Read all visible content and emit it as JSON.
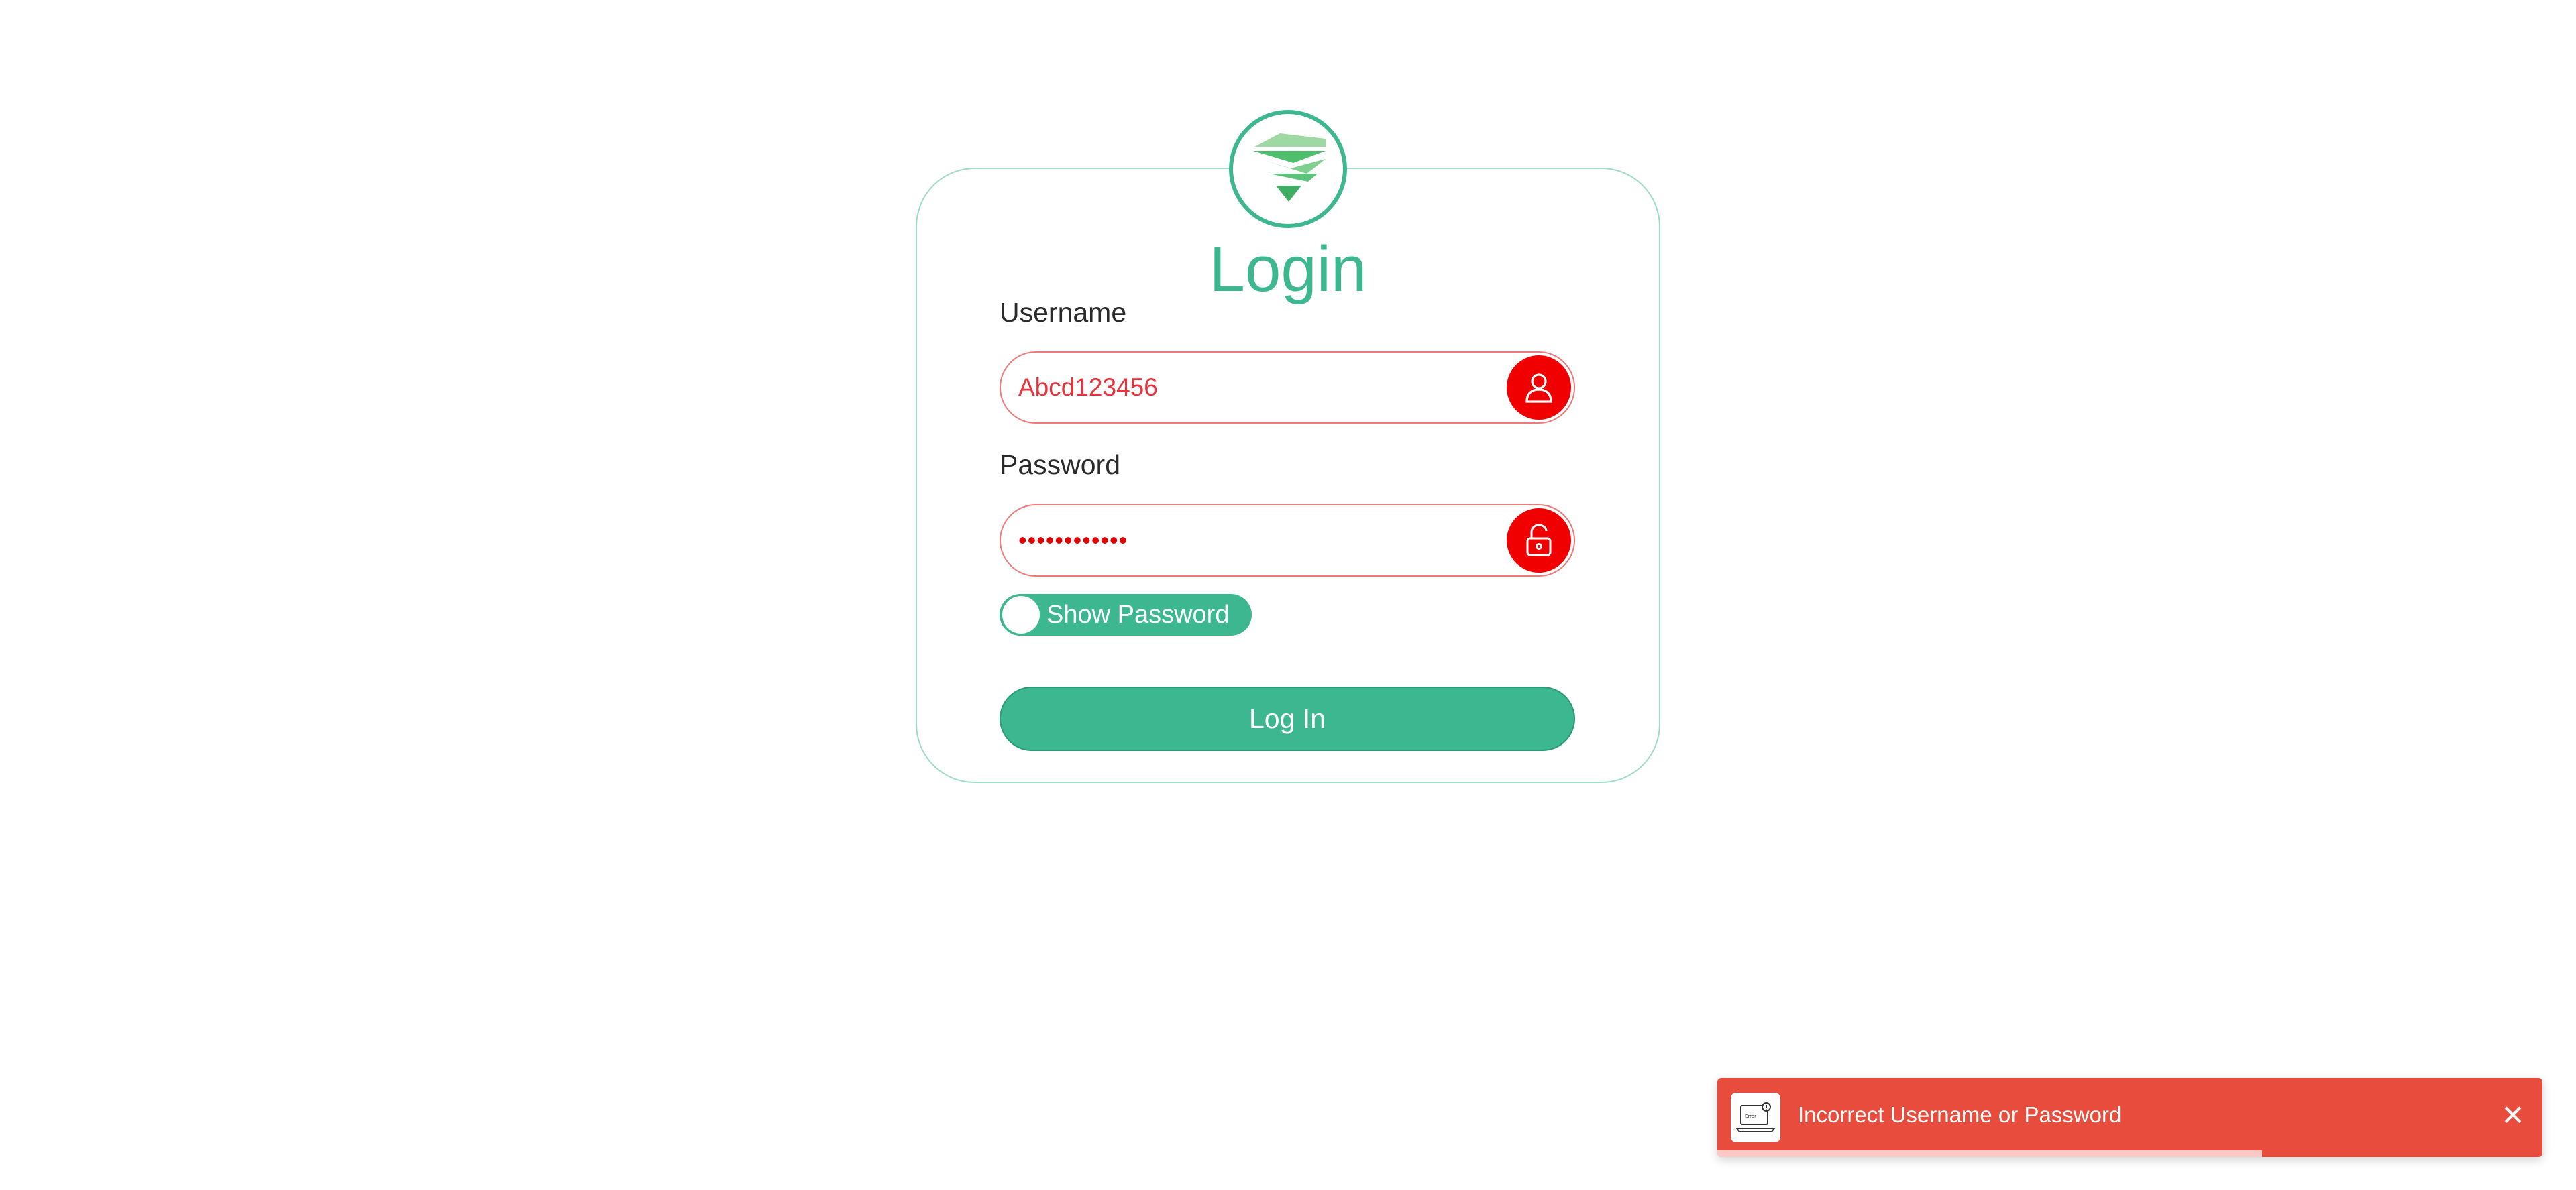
{
  "login": {
    "title": "Login",
    "username_label": "Username",
    "username_value": "Abcd123456",
    "password_label": "Password",
    "password_mask": "••••••••••••",
    "show_password_label": "Show Password",
    "login_button_label": "Log In"
  },
  "toast": {
    "message": "Incorrect Username or Password",
    "close_glyph": "✕",
    "icon_text": "Error",
    "progress_fraction": 0.66
  },
  "colors": {
    "accent": "#3db78f",
    "error": "#f00000",
    "toast_bg": "#e74c3c"
  }
}
